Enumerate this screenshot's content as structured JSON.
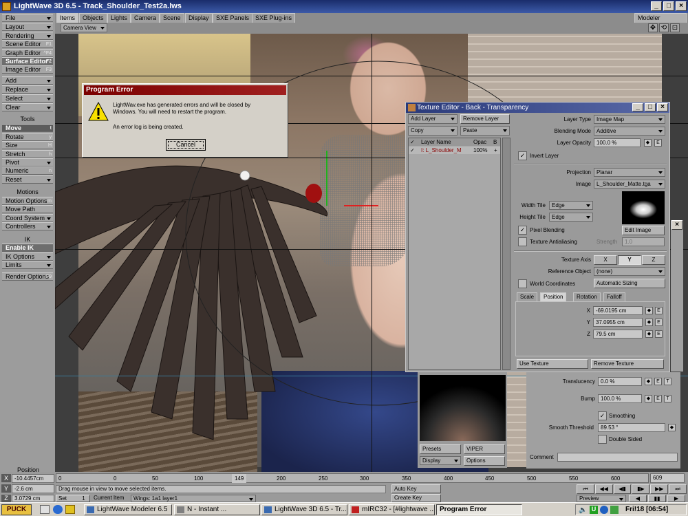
{
  "window": {
    "title": "LightWave 3D 6.5 - Track_Shoulder_Test2a.lws",
    "min": "_",
    "max": "□",
    "close": "×",
    "modeler": "Modeler"
  },
  "sidebar": {
    "items": [
      {
        "label": "File"
      },
      {
        "label": "Layout"
      },
      {
        "label": "Rendering"
      },
      {
        "label": "Scene Editor",
        "key": "F1"
      },
      {
        "label": "Graph Editor",
        "key": "^F4"
      },
      {
        "label": "Surface Editor",
        "key": "F2"
      },
      {
        "label": "Image Editor",
        "key": "F3"
      },
      {
        "label": "Add"
      },
      {
        "label": "Replace"
      },
      {
        "label": "Select"
      },
      {
        "label": "Clear"
      }
    ],
    "tools_header": "Tools",
    "tools": [
      {
        "label": "Move",
        "key": "t"
      },
      {
        "label": "Rotate",
        "key": "y"
      },
      {
        "label": "Size",
        "key": "H"
      },
      {
        "label": "Stretch",
        "key": "h"
      },
      {
        "label": "Pivot"
      },
      {
        "label": "Numeric",
        "key": "n"
      },
      {
        "label": "Reset"
      }
    ],
    "motions_header": "Motions",
    "motions": [
      {
        "label": "Motion Options",
        "key": "m"
      },
      {
        "label": "Move Path"
      },
      {
        "label": "Coord System"
      },
      {
        "label": "Controllers"
      }
    ],
    "ik_header": "IK",
    "ik": [
      {
        "label": "Enable IK"
      },
      {
        "label": "IK Options"
      },
      {
        "label": "Limits"
      }
    ],
    "render_options": "Render Options",
    "render_key": "F9"
  },
  "tabs": [
    "Items",
    "Objects",
    "Lights",
    "Camera",
    "Scene",
    "Display",
    "SXE Panels",
    "SXE Plug-ins"
  ],
  "camera_view": "Camera View",
  "error_dialog": {
    "title": "Program Error",
    "line1": "LightWav.exe has generated errors and will be closed by",
    "line2": "Windows.  You will need to restart the program.",
    "line3": "An error log is being created.",
    "cancel": "Cancel"
  },
  "texture_editor": {
    "title": "Texture Editor - Back - Transparency",
    "add_layer": "Add Layer",
    "remove_layer": "Remove Layer",
    "copy": "Copy",
    "paste": "Paste",
    "col_layer": "Layer Name",
    "col_opac": "Opac",
    "col_b": "B",
    "layer_name": "I: L_Shoulder_M",
    "layer_opac": "100%",
    "layer_b": "+",
    "layer_type_label": "Layer Type",
    "layer_type": "Image Map",
    "blending_label": "Blending Mode",
    "blending": "Additive",
    "opacity_label": "Layer Opacity",
    "opacity": "100.0 %",
    "invert_layer": "Invert Layer",
    "projection_label": "Projection",
    "projection": "Planar",
    "image_label": "Image",
    "image": "L_Shoulder_Matte.tga",
    "width_tile_label": "Width Tile",
    "width_tile": "Edge",
    "height_tile_label": "Height Tile",
    "height_tile": "Edge",
    "edit_image": "Edit Image",
    "pixel_blending": "Pixel Blending",
    "texture_antialiasing": "Texture Antialiasing",
    "strength_label": "Strength",
    "strength": "1.0",
    "texture_axis_label": "Texture Axis",
    "axis_x": "X",
    "axis_y": "Y",
    "axis_z": "Z",
    "ref_object_label": "Reference Object",
    "ref_object": "(none)",
    "world_coords": "World Coordinates",
    "auto_sizing": "Automatic Sizing",
    "subtabs": [
      "Scale",
      "Position",
      "Rotation",
      "Falloff"
    ],
    "x_label": "X",
    "x_val": "-69.0195 cm",
    "y_label": "Y",
    "y_val": "37.0955 cm",
    "z_label": "Z",
    "z_val": "79.5 cm",
    "use_texture": "Use Texture",
    "remove_texture": "Remove Texture",
    "env": "E"
  },
  "surface": {
    "translucency_label": "Translucency",
    "translucency": "0.0 %",
    "bump_label": "Bump",
    "bump": "100.0 %",
    "smoothing": "Smoothing",
    "smooth_threshold_label": "Smooth Threshold",
    "smooth_threshold": "89.53 °",
    "double_sided": "Double Sided",
    "comment_label": "Comment",
    "presets": "Presets",
    "viper": "VIPER",
    "display": "Display",
    "options": "Options"
  },
  "bottom": {
    "position_label": "Position",
    "x_label": "X",
    "x_val": "-10.4457cm",
    "y_label": "Y",
    "y_val": "-2.6 cm",
    "z_label": "Z",
    "z_val": "3.0729 cm",
    "frame_start": "0",
    "frame_end": "609",
    "ticks": [
      "0",
      "50",
      "100",
      "149",
      "200",
      "250",
      "300",
      "350",
      "400",
      "450",
      "500",
      "550",
      "600"
    ],
    "status": "Drag mouse in view to move selected items.",
    "set": "Set",
    "set_val": "1",
    "current_item_label": "Current Item",
    "current_item": "Wings: 1a1 layer1",
    "auto_key": "Auto Key",
    "create_key": "Create Key",
    "preview": "Preview"
  },
  "taskbar": {
    "start": "PUCK",
    "tasks": [
      "LightWave Modeler 6.5",
      "N - Instant ...",
      "LightWave 3D 6.5 - Tr...",
      "mIRC32 - [#lightwave ...",
      "Program Error"
    ],
    "clock": "Fri!18  [06:54]"
  }
}
